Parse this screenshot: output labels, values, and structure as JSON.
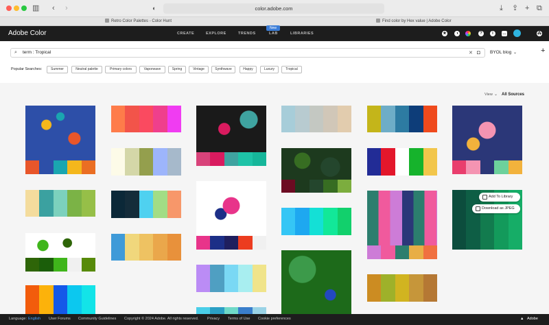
{
  "browser": {
    "url": "color.adobe.com",
    "tabs": [
      {
        "title": "Retro Color Palettes - Color Hunt"
      },
      {
        "title": "Find color by Hex value | Adobe Color"
      }
    ]
  },
  "nav": {
    "brand": "Adobe Color",
    "items": [
      "CREATE",
      "EXPLORE",
      "TRENDS",
      "LAB",
      "LIBRARIES"
    ],
    "new_badge": "New"
  },
  "search": {
    "value": "term : Tropical",
    "source_select": "BYOL blog"
  },
  "popular": {
    "label": "Popular Searches:",
    "chips": [
      "Summer",
      "Neutral palette",
      "Primary colors",
      "Vaporwave",
      "Spring",
      "Vintage",
      "Synthwave",
      "Happy",
      "Luxury",
      "Tropical"
    ]
  },
  "view": {
    "label": "View",
    "selected": "All Sources"
  },
  "overlay": {
    "add_library": "Add To Library",
    "download_jpeg": "Download as JPEG"
  },
  "palettes": {
    "p1": [
      "#e8562a",
      "#2d4fa8",
      "#1aa6b0",
      "#f4b71c",
      "#ea6e23"
    ],
    "p2": [
      "#fe7c4a",
      "#f2544a",
      "#fa4a60",
      "#ef3f8c",
      "#f03cf2"
    ],
    "p3": [
      "#d8437a",
      "#d91b5f",
      "#3fa3a0",
      "#1ec3a7",
      "#16b69a"
    ],
    "p4": [
      "#a7cdd9",
      "#b8cbd0",
      "#c4c8c2",
      "#d1c7b8",
      "#e2ccae"
    ],
    "p5": [
      "#c4b51a",
      "#6eadc7",
      "#2d7ba2",
      "#0d3d79",
      "#ef4a1d"
    ],
    "p6": [
      "#e93e6d",
      "#f494b2",
      "#2b3778",
      "#6dd19c",
      "#f2b23c"
    ],
    "p7": [
      "#f4dc9d",
      "#3ba1a0",
      "#7cd1bd",
      "#7bb346",
      "#96bf48"
    ],
    "p8": [
      "#fdfbe8",
      "#d4d7a8",
      "#949f4d",
      "#9db5fb",
      "#a6b9cb"
    ],
    "p9": [
      "#6c0b22",
      "#1d3a1e",
      "#24462d",
      "#376d22",
      "#7cad3e"
    ],
    "p10": [
      "#222c96",
      "#e3172b",
      "#ffffff",
      "#16b32c",
      "#f2c64b"
    ],
    "p11": [
      "#0b2838",
      "#142c3a",
      "#4fd1f0",
      "#a2dd85",
      "#f7976a"
    ],
    "p12": [
      "#e8348a",
      "#1c2f87",
      "#1f1f5e",
      "#ec3c1f",
      "#f0f0f0"
    ],
    "p13": [
      "#35c6f5",
      "#1ea8f0",
      "#14e0d6",
      "#12e899",
      "#12d06c"
    ],
    "p14": [
      "#cd7cd7",
      "#f05a9d",
      "#2c7e6e",
      "#e8ae46",
      "#f07040"
    ],
    "p15": [
      "#3f9ad8",
      "#f0d77c",
      "#eec262",
      "#eaa74b",
      "#e8913b"
    ],
    "p16": [
      "#0c4d3d",
      "#0e5e45",
      "#127b4e",
      "#139a5b",
      "#16ad67"
    ],
    "p17": [
      "#9ae03d",
      "#3c9a4a",
      "#c8d35a",
      "#8cc63f",
      "#ffffff"
    ],
    "p18": [
      "#2e6508",
      "#1b5e0a",
      "#3fb51b",
      "#f0f0f0",
      "#578a0a"
    ],
    "p19": [
      "#cc8c22",
      "#9eb12a",
      "#d1b420",
      "#c6963a",
      "#b57834"
    ],
    "p20": [
      "#bb8cf5",
      "#4f9fc2",
      "#7ad8f4",
      "#a8eef0",
      "#f0e48a"
    ],
    "p21": [
      "#f25c0c",
      "#fcb20b",
      "#1558e8",
      "#0cc8ef",
      "#13e4e8"
    ],
    "p22": [
      "#4acee8",
      "#2b9fc4",
      "#6fd9c8",
      "#3a7ecb",
      "#9ad3e6"
    ]
  },
  "footer": {
    "language_label": "Language:",
    "language_value": "English",
    "links": [
      "User Forums",
      "Community Guidelines",
      "Copyright © 2024 Adobe. All rights reserved.",
      "Privacy",
      "Terms of Use",
      "Cookie preferences"
    ],
    "brand": "Adobe"
  }
}
